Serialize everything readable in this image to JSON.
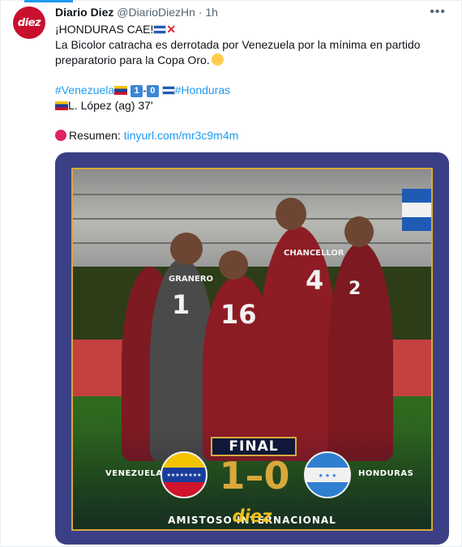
{
  "tweet": {
    "author_name": "Diario Diez",
    "handle": "@DiarioDiezHn",
    "separator": "·",
    "time": "1h",
    "avatar_text": "diez",
    "more_icon": "more-dots-icon",
    "line1": "¡HONDURAS CAE!",
    "line2": "La Bicolor catracha es derrotada por Venezuela por la mínima en partido preparatorio para la Copa Oro.",
    "hashtag_ve": "#Venezuela",
    "score_home": "1",
    "score_dash": "-",
    "score_away": "0",
    "hashtag_hn": "#Honduras",
    "scorer": "L. López (ag) 37'",
    "resumen_label": "Resumen:",
    "resumen_link": "tinyurl.com/mr3c9m4m"
  },
  "media": {
    "final_label": "FINAL",
    "home_team": "VENEZUELA",
    "away_team": "HONDURAS",
    "home_score": "1",
    "score_sep": "–",
    "away_score": "0",
    "competition": "AMISTOSO INTERNACIONAL",
    "brand": "diez",
    "player_names": [
      "CHANCELLOR",
      "GRANERO"
    ],
    "player_numbers": [
      "4",
      "16",
      "1",
      "2"
    ]
  },
  "colors": {
    "link": "#1d9bf0",
    "brand_red": "#c8102e",
    "gold": "#d8a83b",
    "venezuela_kit": "#8c1b24"
  }
}
